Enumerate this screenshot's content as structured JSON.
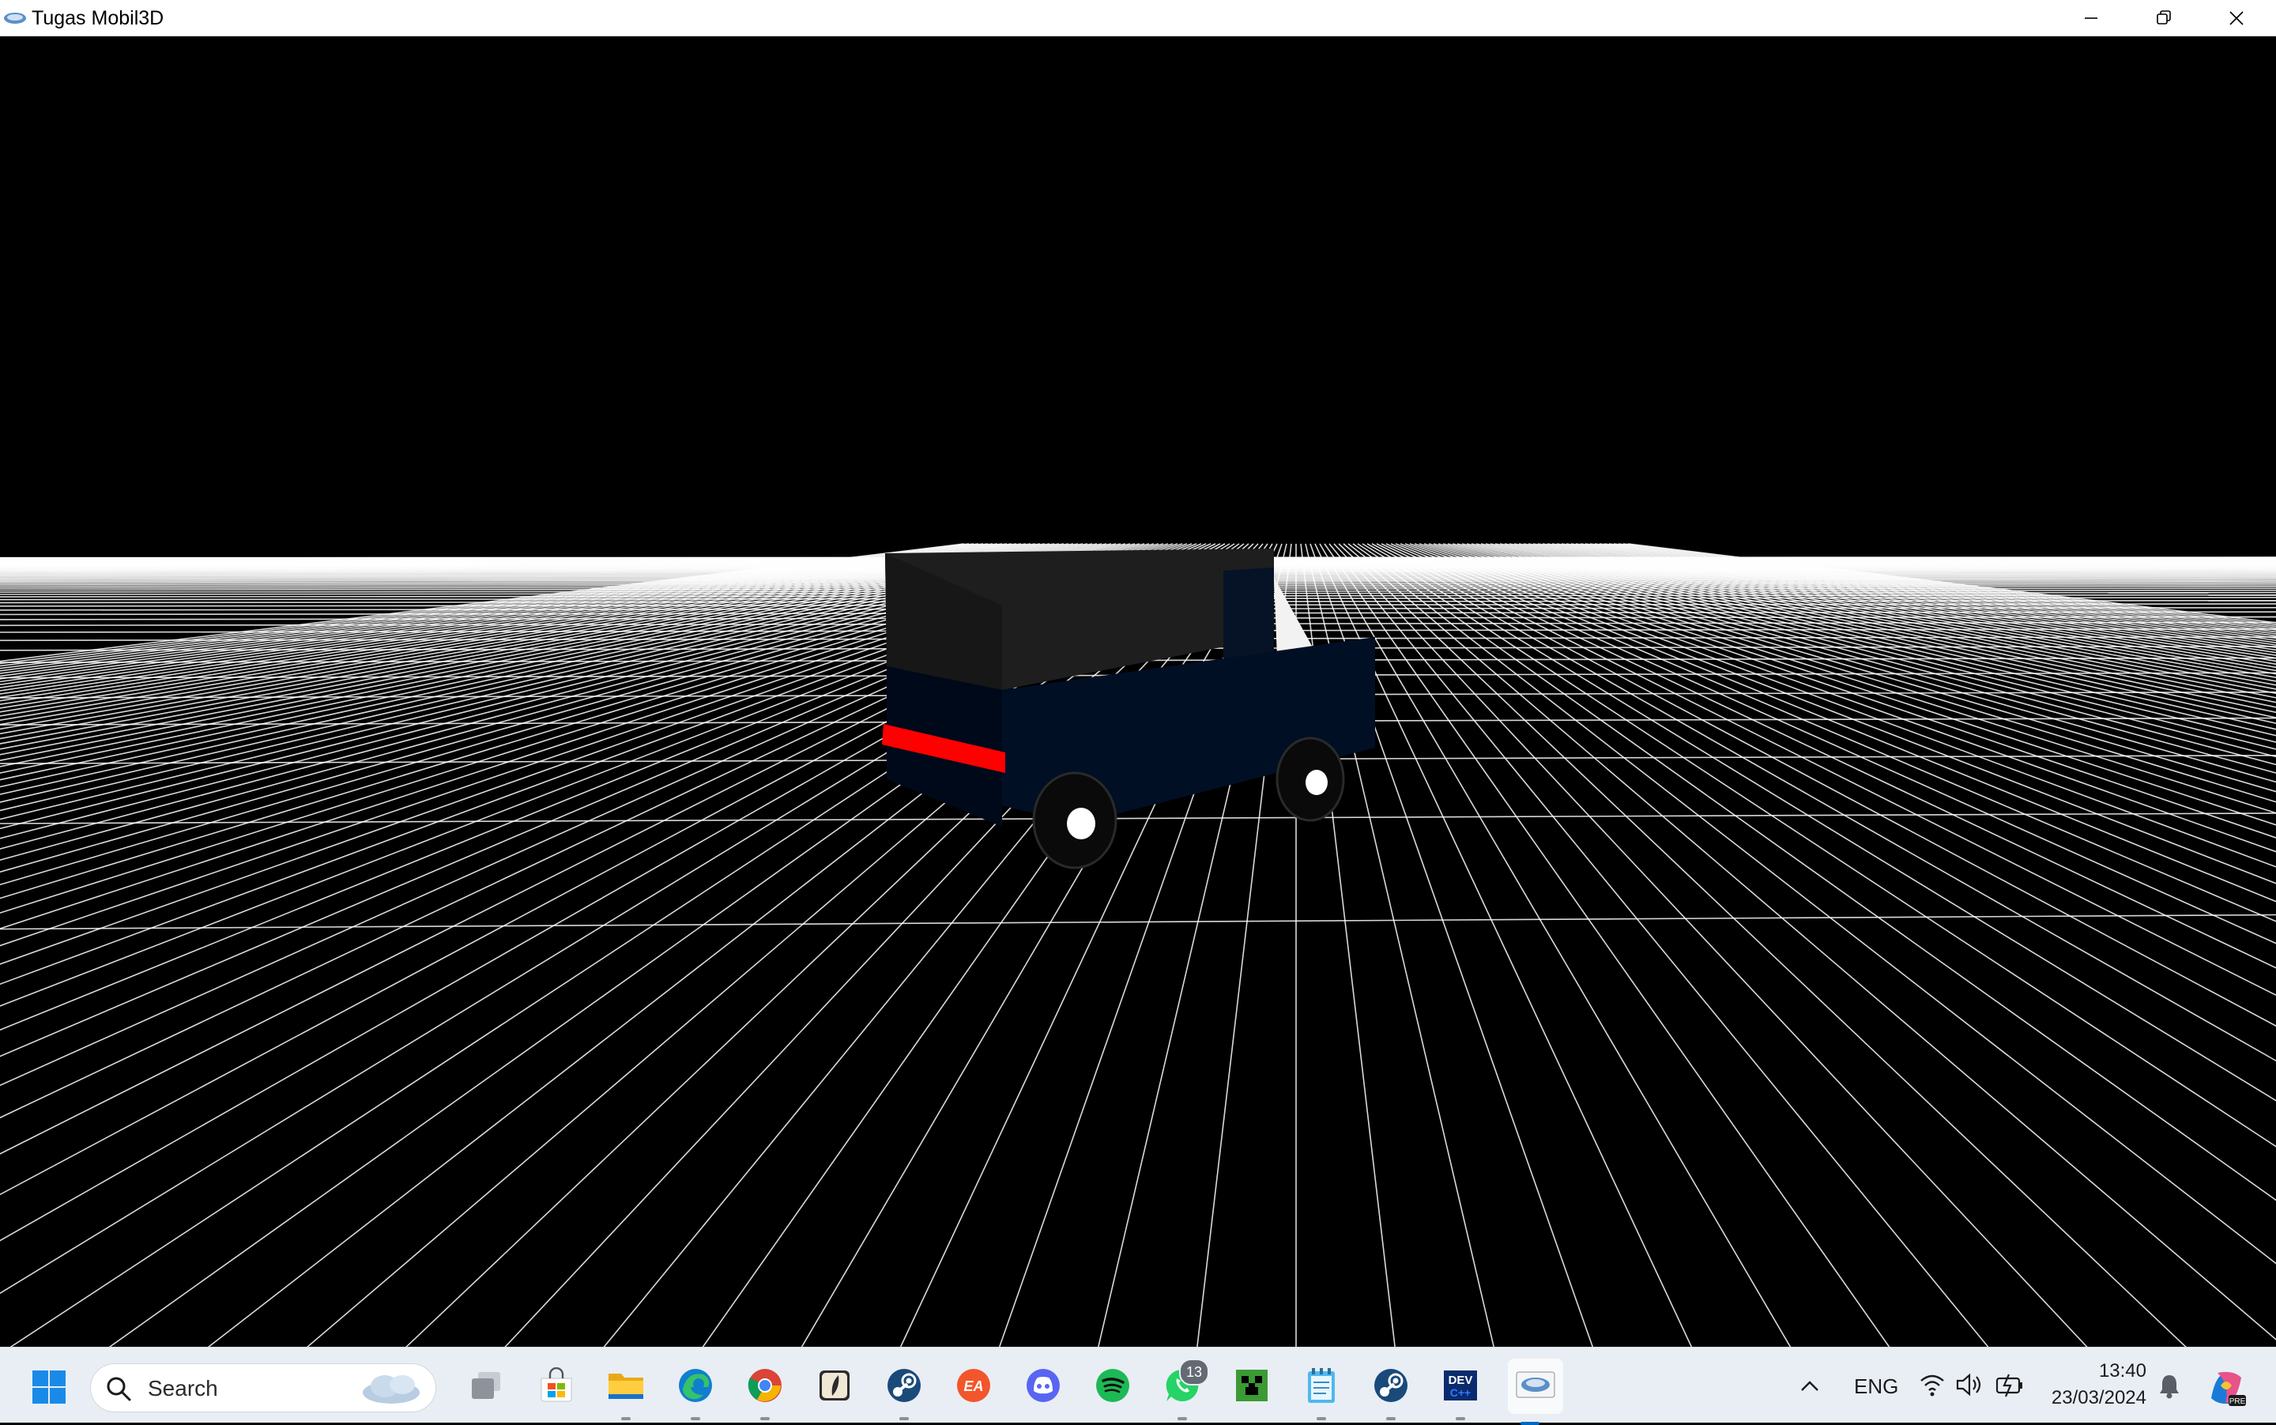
{
  "window": {
    "title": "Tugas Mobil3D",
    "controls": {
      "minimize": "minimize",
      "restore": "restore",
      "close": "close"
    }
  },
  "scene": {
    "background_color": "#000000",
    "grid_color": "#ffffff",
    "car": {
      "cargo_color": "#1e1e1e",
      "body_color": "#000f24",
      "stripe_color": "#ff0000",
      "windshield_color": "#f2f2f2",
      "wheel_color": "#0a0a0a",
      "hub_color": "#ffffff"
    }
  },
  "taskbar": {
    "search_placeholder": "Search",
    "pinned_apps": [
      {
        "name": "start",
        "icon": "windows-logo-icon"
      },
      {
        "name": "task-view",
        "icon": "task-view-icon"
      },
      {
        "name": "microsoft-store",
        "icon": "store-icon"
      },
      {
        "name": "file-explorer",
        "icon": "folder-icon"
      },
      {
        "name": "edge",
        "icon": "edge-icon"
      },
      {
        "name": "chrome",
        "icon": "chrome-icon"
      },
      {
        "name": "app-feather",
        "icon": "feather-icon"
      },
      {
        "name": "steam",
        "icon": "steam-icon"
      },
      {
        "name": "ea",
        "icon": "ea-icon"
      },
      {
        "name": "discord",
        "icon": "discord-icon"
      },
      {
        "name": "spotify",
        "icon": "spotify-icon"
      },
      {
        "name": "whatsapp",
        "icon": "whatsapp-icon",
        "badge": "13"
      },
      {
        "name": "minecraft",
        "icon": "creeper-icon"
      },
      {
        "name": "notepad",
        "icon": "notepad-icon"
      },
      {
        "name": "steam-2",
        "icon": "steam-icon"
      },
      {
        "name": "dev-cpp",
        "icon": "dev-cpp-icon",
        "label": "DEV"
      },
      {
        "name": "opengl-app",
        "icon": "opengl-icon"
      }
    ],
    "tray": {
      "language": "ENG",
      "time": "13:40",
      "date": "23/03/2024"
    }
  }
}
